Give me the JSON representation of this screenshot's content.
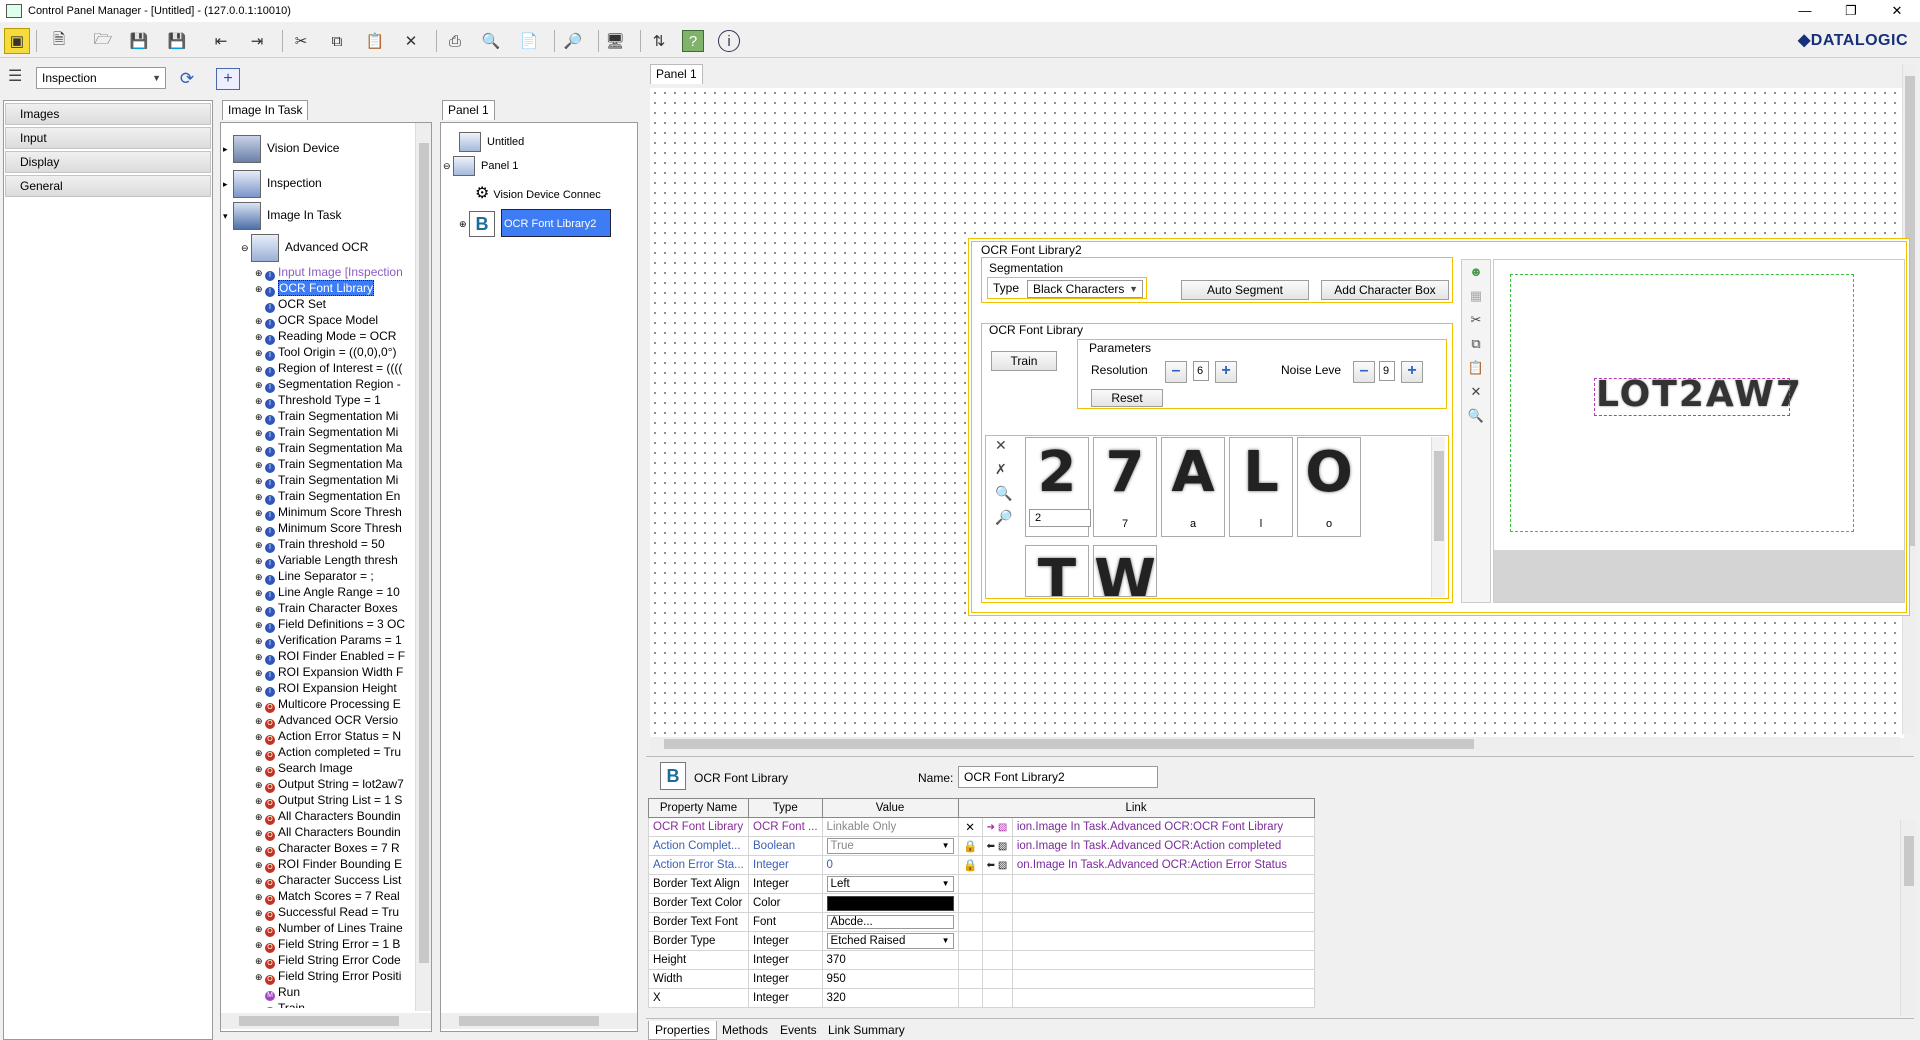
{
  "window": {
    "title": "Control Panel Manager - [Untitled] - (127.0.0.1:10010)"
  },
  "brand": {
    "logo": "◆DATALOGIC"
  },
  "toolbar": {
    "icons": [
      "monitor-select-icon",
      "new-doc-icon",
      "open-folder-icon",
      "save-icon",
      "save-all-icon",
      "import-icon",
      "export-icon",
      "cut-icon",
      "copy-icon",
      "paste-icon",
      "delete-icon",
      "print-icon",
      "print-preview-icon",
      "page-setup-icon",
      "find-icon",
      "display-icon",
      "connect-icon",
      "help-icon",
      "about-icon"
    ]
  },
  "inspection_select": {
    "value": "Inspection"
  },
  "left_nav": {
    "items": [
      "Images",
      "Input",
      "Display",
      "General"
    ]
  },
  "image_tree": {
    "tab": "Image In Task",
    "nodes": [
      "Vision Device",
      "Inspection",
      "Image In Task",
      "Advanced OCR"
    ],
    "children": [
      {
        "label": "Input Image [Inspection",
        "kind": "i",
        "style": "link"
      },
      {
        "label": "OCR Font Library",
        "kind": "i",
        "style": "sel"
      },
      {
        "label": "OCR Set",
        "kind": "i",
        "style": "noexp"
      },
      {
        "label": "OCR Space Model",
        "kind": "i"
      },
      {
        "label": "Reading Mode = OCR",
        "kind": "i"
      },
      {
        "label": "Tool Origin = ((0,0),0°)",
        "kind": "i"
      },
      {
        "label": "Region of Interest = ((((",
        "kind": "i"
      },
      {
        "label": "Segmentation Region -",
        "kind": "i"
      },
      {
        "label": "Threshold Type = 1",
        "kind": "i"
      },
      {
        "label": "Train Segmentation Mi",
        "kind": "i"
      },
      {
        "label": "Train Segmentation Mi",
        "kind": "i"
      },
      {
        "label": "Train Segmentation Ma",
        "kind": "i"
      },
      {
        "label": "Train Segmentation Ma",
        "kind": "i"
      },
      {
        "label": "Train Segmentation Mi",
        "kind": "i"
      },
      {
        "label": "Train Segmentation En",
        "kind": "i"
      },
      {
        "label": "Minimum Score Thresh",
        "kind": "i"
      },
      {
        "label": "Minimum Score Thresh",
        "kind": "i"
      },
      {
        "label": "Train threshold = 50",
        "kind": "i"
      },
      {
        "label": "Variable Length thresh",
        "kind": "i"
      },
      {
        "label": "Line Separator = ;",
        "kind": "i"
      },
      {
        "label": "Line Angle Range = 10",
        "kind": "i"
      },
      {
        "label": "Train Character Boxes",
        "kind": "i"
      },
      {
        "label": "Field Definitions = 3 OC",
        "kind": "i"
      },
      {
        "label": "Verification Params = 1",
        "kind": "i"
      },
      {
        "label": "ROI Finder Enabled = F",
        "kind": "i"
      },
      {
        "label": "ROI Expansion Width F",
        "kind": "i"
      },
      {
        "label": "ROI Expansion Height",
        "kind": "i"
      },
      {
        "label": "Multicore Processing E",
        "kind": "o"
      },
      {
        "label": "Advanced OCR Versio",
        "kind": "o"
      },
      {
        "label": "Action Error Status = N",
        "kind": "o"
      },
      {
        "label": "Action completed = Tru",
        "kind": "o"
      },
      {
        "label": "Search Image",
        "kind": "o"
      },
      {
        "label": "Output String = lot2aw7",
        "kind": "o"
      },
      {
        "label": "Output String List = 1 S",
        "kind": "o"
      },
      {
        "label": "All Characters Boundin",
        "kind": "o"
      },
      {
        "label": "All Characters Boundin",
        "kind": "o"
      },
      {
        "label": "Character Boxes = 7 R",
        "kind": "o"
      },
      {
        "label": "ROI Finder Bounding E",
        "kind": "o"
      },
      {
        "label": "Character Success List",
        "kind": "o"
      },
      {
        "label": "Match Scores = 7 Real",
        "kind": "o"
      },
      {
        "label": "Successful Read = Tru",
        "kind": "o"
      },
      {
        "label": "Number of Lines Traine",
        "kind": "o"
      },
      {
        "label": "Field String Error = 1 B",
        "kind": "o"
      },
      {
        "label": "Field String Error Code",
        "kind": "o"
      },
      {
        "label": "Field String Error Positi",
        "kind": "o"
      },
      {
        "label": "Run",
        "kind": "m",
        "style": "noexp"
      },
      {
        "label": "Train",
        "kind": "m",
        "style": "noexp"
      }
    ]
  },
  "panel_tree": {
    "tab": "Panel 1",
    "nodes": [
      "Untitled",
      "Panel 1",
      "Vision Device Connec",
      "OCR Font Library2"
    ]
  },
  "canvas": {
    "tab": "Panel 1"
  },
  "widget": {
    "title": "OCR Font Library2",
    "segmentation": "Segmentation",
    "type_label": "Type",
    "type_value": "Black Characters",
    "auto_segment": "Auto Segment",
    "add_char_box": "Add Character Box",
    "ocr_library": "OCR Font Library",
    "train": "Train",
    "parameters": "Parameters",
    "resolution_label": "Resolution",
    "resolution_value": "6",
    "noise_label": "Noise Leve",
    "noise_value": "9",
    "reset": "Reset",
    "glyphs": [
      {
        "ch": "2",
        "label": "2"
      },
      {
        "ch": "7",
        "label": "7"
      },
      {
        "ch": "A",
        "label": "a"
      },
      {
        "ch": "L",
        "label": "l"
      },
      {
        "ch": "O",
        "label": "o"
      },
      {
        "ch": "T",
        "label": ""
      },
      {
        "ch": "W",
        "label": ""
      }
    ],
    "glyph_edit_value": "2",
    "preview_text": "LOT2AW7"
  },
  "props": {
    "component_name": "OCR Font Library",
    "name_label": "Name:",
    "name_value": "OCR Font Library2",
    "headers": [
      "Property Name",
      "Type",
      "Value",
      "Link"
    ],
    "rows": [
      {
        "name": "OCR Font Library",
        "type": "OCR Font ...",
        "value": "Linkable Only",
        "link": "ion.Image In Task.Advanced OCR:OCR Font Library",
        "cls": "purple"
      },
      {
        "name": "Action Complet...",
        "type": "Boolean",
        "value": "True",
        "link": "ion.Image In Task.Advanced OCR:Action completed",
        "cls": "blue"
      },
      {
        "name": "Action Error Sta...",
        "type": "Integer",
        "value": "0",
        "link": "on.Image In Task.Advanced OCR:Action Error Status",
        "cls": "blue"
      },
      {
        "name": "Border Text Align",
        "type": "Integer",
        "value": "Left",
        "link": "",
        "cls": ""
      },
      {
        "name": "Border Text Color",
        "type": "Color",
        "value": "",
        "link": "",
        "cls": ""
      },
      {
        "name": "Border Text Font",
        "type": "Font",
        "value": "Abcde...",
        "link": "",
        "cls": ""
      },
      {
        "name": "Border Type",
        "type": "Integer",
        "value": "Etched Raised",
        "link": "",
        "cls": ""
      },
      {
        "name": "Height",
        "type": "Integer",
        "value": "370",
        "link": "",
        "cls": ""
      },
      {
        "name": "Width",
        "type": "Integer",
        "value": "950",
        "link": "",
        "cls": ""
      },
      {
        "name": "X",
        "type": "Integer",
        "value": "320",
        "link": "",
        "cls": ""
      }
    ],
    "tabs": [
      "Properties",
      "Methods",
      "Events",
      "Link Summary"
    ]
  }
}
